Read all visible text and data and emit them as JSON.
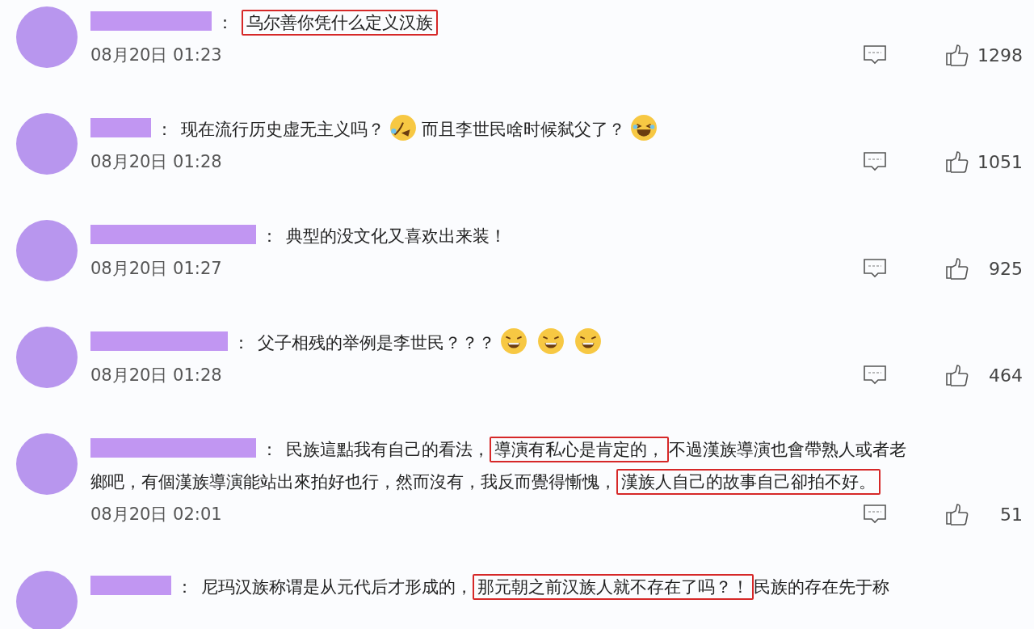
{
  "comments": [
    {
      "separator": "：",
      "segments": [
        {
          "kind": "text",
          "text": "乌尔善你凭什么定义汉族",
          "highlighted": true
        }
      ],
      "time": "08月20日 01:23",
      "likes": "1298"
    },
    {
      "separator": "：",
      "segments": [
        {
          "kind": "text",
          "text": "现在流行历史虚无主义吗？",
          "highlighted": false
        },
        {
          "kind": "fallen-emoji"
        },
        {
          "kind": "text",
          "text": "而且李世民啥时候弑父了？",
          "highlighted": false
        },
        {
          "kind": "laugh-emoji"
        }
      ],
      "time": "08月20日 01:28",
      "likes": "1051"
    },
    {
      "separator": "：",
      "segments": [
        {
          "kind": "text",
          "text": "典型的没文化又喜欢出来装！",
          "highlighted": false
        }
      ],
      "time": "08月20日 01:27",
      "likes": "925"
    },
    {
      "separator": "：",
      "segments": [
        {
          "kind": "text",
          "text": "父子相残的举例是李世民？？？",
          "highlighted": false
        },
        {
          "kind": "grin-emoji"
        },
        {
          "kind": "grin-emoji"
        },
        {
          "kind": "grin-emoji"
        }
      ],
      "time": "08月20日 01:28",
      "likes": "464"
    },
    {
      "separator": "：",
      "segments": [
        {
          "kind": "text",
          "text": "民族這點我有自己的看法，",
          "highlighted": false
        },
        {
          "kind": "text",
          "text": "導演有私心是肯定的，",
          "highlighted": true
        },
        {
          "kind": "text",
          "text": "不過漢族導演也會帶熟人或者老",
          "highlighted": false
        },
        {
          "kind": "text",
          "text": "鄉吧，有個漢族導演能站出來拍好也行，然而沒有，我反而覺得慚愧，",
          "highlighted": false
        },
        {
          "kind": "text",
          "text": "漢族人自己的故事自己卻拍不好。",
          "highlighted": true
        }
      ],
      "time": "08月20日 02:01",
      "likes": "51"
    },
    {
      "separator": "：",
      "segments": [
        {
          "kind": "text",
          "text": "尼玛汉族称谓是从元代后才形成的，",
          "highlighted": false
        },
        {
          "kind": "text",
          "text": "那元朝之前汉族人就不存在了吗？！",
          "highlighted": true
        },
        {
          "kind": "text",
          "text": "民族的存在先于称",
          "highlighted": false
        }
      ]
    }
  ]
}
